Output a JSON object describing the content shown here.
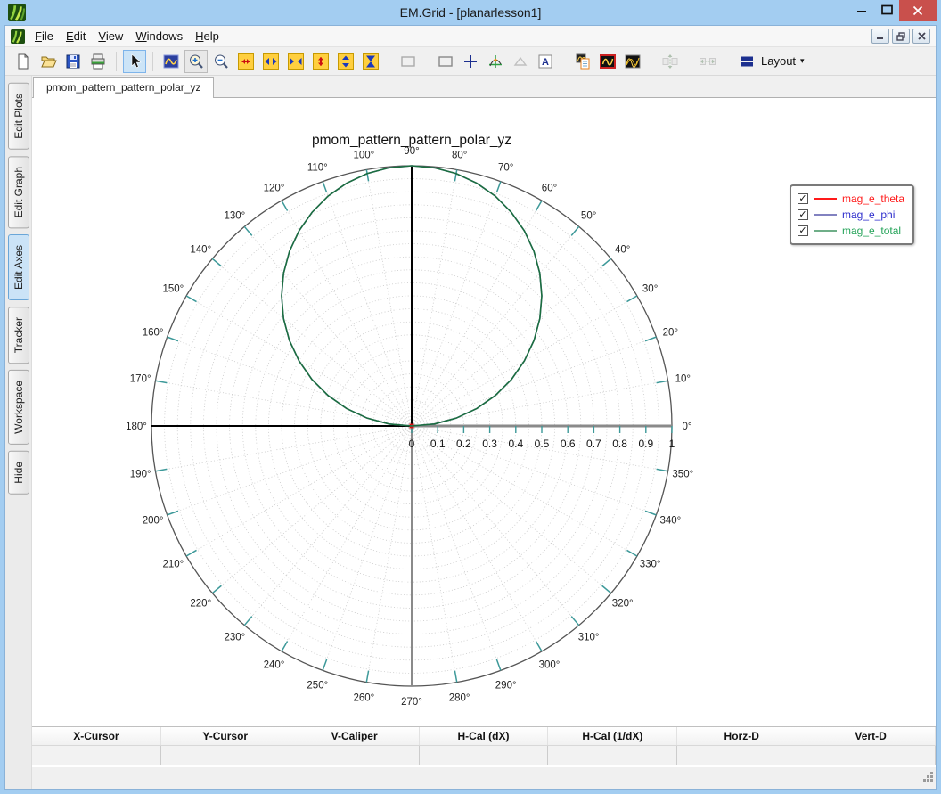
{
  "window": {
    "title": "EM.Grid - [planarlesson1]"
  },
  "menubar": {
    "items": [
      {
        "label": "File",
        "accel": 0
      },
      {
        "label": "Edit",
        "accel": 0
      },
      {
        "label": "View",
        "accel": 0
      },
      {
        "label": "Windows",
        "accel": 0
      },
      {
        "label": "Help",
        "accel": 0
      }
    ],
    "mdi_controls": [
      "mdi-minimize",
      "mdi-restore",
      "mdi-close"
    ]
  },
  "toolbar": {
    "layout_label": "Layout",
    "layout_caret": "▾",
    "buttons": [
      {
        "icon": "new-file"
      },
      {
        "icon": "open-file"
      },
      {
        "icon": "save-file"
      },
      {
        "icon": "print"
      },
      {
        "sep": true
      },
      {
        "icon": "select-cursor",
        "state": "active"
      },
      {
        "sep": true
      },
      {
        "icon": "zoom-window"
      },
      {
        "icon": "zoom-in",
        "state": "toggled"
      },
      {
        "icon": "zoom-out"
      },
      {
        "icon": "expand-x"
      },
      {
        "icon": "shrink-x"
      },
      {
        "icon": "compress-x"
      },
      {
        "icon": "expand-y"
      },
      {
        "icon": "shrink-y"
      },
      {
        "icon": "compress-y"
      },
      {
        "gap": true
      },
      {
        "icon": "select-rect"
      },
      {
        "gap": true
      },
      {
        "icon": "select-rect-2"
      },
      {
        "icon": "crosshair"
      },
      {
        "icon": "tracker-axes"
      },
      {
        "icon": "caliper-triangle",
        "state": "disabled"
      },
      {
        "icon": "add-text"
      },
      {
        "gap": true
      },
      {
        "icon": "show-legend"
      },
      {
        "icon": "plot-frame"
      },
      {
        "icon": "plot-curves"
      },
      {
        "gap": true
      },
      {
        "icon": "fit-vertical",
        "state": "disabled"
      },
      {
        "gap": true
      },
      {
        "icon": "fit-horizontal",
        "state": "disabled"
      },
      {
        "gap": true
      }
    ]
  },
  "sidebar": {
    "tabs": [
      {
        "label": "Edit Plots",
        "active": false
      },
      {
        "label": "Edit Graph",
        "active": false
      },
      {
        "label": "Edit Axes",
        "active": true
      },
      {
        "label": "Tracker",
        "active": false
      },
      {
        "label": "Workspace",
        "active": false
      },
      {
        "label": "Hide",
        "active": false
      }
    ]
  },
  "tabstrip": {
    "tabs": [
      {
        "label": "pmom_pattern_pattern_polar_yz",
        "active": true
      }
    ]
  },
  "chart_data": {
    "type": "polar-line",
    "title": "pmom_pattern_pattern_polar_yz",
    "radial_range": [
      0,
      1
    ],
    "radial_tick_labels": [
      "0",
      "0.1",
      "0.2",
      "0.3",
      "0.4",
      "0.5",
      "0.6",
      "0.7",
      "0.8",
      "0.9",
      "1"
    ],
    "angle_labels": [
      "0°",
      "10°",
      "20°",
      "30°",
      "40°",
      "50°",
      "60°",
      "70°",
      "80°",
      "90°",
      "100°",
      "110°",
      "120°",
      "130°",
      "140°",
      "150°",
      "160°",
      "170°",
      "180°",
      "190°",
      "200°",
      "210°",
      "220°",
      "230°",
      "240°",
      "250°",
      "260°",
      "270°",
      "280°",
      "290°",
      "300°",
      "310°",
      "320°",
      "330°",
      "340°",
      "350°"
    ],
    "spoke_step_deg": 10,
    "ring_step_fraction": 0.05,
    "grid_style": "dotted",
    "legend_position": "right",
    "angles_deg": [
      0,
      5,
      10,
      15,
      20,
      25,
      30,
      35,
      40,
      45,
      50,
      55,
      60,
      65,
      70,
      75,
      80,
      85,
      90,
      95,
      100,
      105,
      110,
      115,
      120,
      125,
      130,
      135,
      140,
      145,
      150,
      155,
      160,
      165,
      170,
      175,
      180,
      185,
      190,
      195,
      200,
      205,
      210,
      215,
      220,
      225,
      230,
      235,
      240,
      245,
      250,
      255,
      260,
      265,
      270,
      275,
      280,
      285,
      290,
      295,
      300,
      305,
      310,
      315,
      320,
      325,
      330,
      335,
      340,
      345,
      350,
      355,
      360
    ],
    "series": [
      {
        "name": "mag_e_theta",
        "color": "#dd1111",
        "values": [
          0,
          0,
          0,
          0,
          0,
          0,
          0,
          0,
          0,
          0,
          0,
          0,
          0,
          0,
          0,
          0,
          0,
          0,
          0,
          0,
          0,
          0,
          0,
          0,
          0,
          0,
          0,
          0,
          0,
          0,
          0,
          0,
          0,
          0,
          0,
          0,
          0,
          0,
          0,
          0,
          0,
          0,
          0,
          0,
          0,
          0,
          0,
          0,
          0,
          0,
          0,
          0,
          0,
          0,
          0,
          0,
          0,
          0,
          0,
          0,
          0,
          0,
          0,
          0,
          0,
          0,
          0,
          0,
          0,
          0,
          0,
          0,
          0
        ]
      },
      {
        "name": "mag_e_phi",
        "color": "#8282c0",
        "values": [
          0,
          0.087,
          0.174,
          0.259,
          0.342,
          0.423,
          0.5,
          0.574,
          0.643,
          0.707,
          0.766,
          0.819,
          0.866,
          0.906,
          0.94,
          0.966,
          0.985,
          0.996,
          1,
          0.996,
          0.985,
          0.966,
          0.94,
          0.906,
          0.866,
          0.819,
          0.766,
          0.707,
          0.643,
          0.574,
          0.5,
          0.423,
          0.342,
          0.259,
          0.174,
          0.087,
          0,
          0,
          0,
          0,
          0,
          0,
          0,
          0,
          0,
          0,
          0,
          0,
          0,
          0,
          0,
          0,
          0,
          0,
          0,
          0,
          0,
          0,
          0,
          0,
          0,
          0,
          0,
          0,
          0,
          0,
          0,
          0,
          0,
          0,
          0,
          0,
          0
        ]
      },
      {
        "name": "mag_e_total",
        "color": "#1b6e3f",
        "values": [
          0,
          0.087,
          0.174,
          0.259,
          0.342,
          0.423,
          0.5,
          0.574,
          0.643,
          0.707,
          0.766,
          0.819,
          0.866,
          0.906,
          0.94,
          0.966,
          0.985,
          0.996,
          1,
          0.996,
          0.985,
          0.966,
          0.94,
          0.906,
          0.866,
          0.819,
          0.766,
          0.707,
          0.643,
          0.574,
          0.5,
          0.423,
          0.342,
          0.259,
          0.174,
          0.087,
          0,
          0,
          0,
          0,
          0,
          0,
          0,
          0,
          0,
          0,
          0,
          0,
          0,
          0,
          0,
          0,
          0,
          0,
          0,
          0,
          0,
          0,
          0,
          0,
          0,
          0,
          0,
          0,
          0,
          0,
          0,
          0,
          0,
          0,
          0,
          0,
          0
        ]
      }
    ]
  },
  "legend": {
    "entries": [
      {
        "label": "mag_e_theta",
        "line_color": "#ff1a1a",
        "text_color": "#ff1a1a",
        "checked": true,
        "check_glyph": "✓"
      },
      {
        "label": "mag_e_phi",
        "line_color": "#8282c0",
        "text_color": "#2d2dcc",
        "checked": true,
        "check_glyph": "✓"
      },
      {
        "label": "mag_e_total",
        "line_color": "#6fae88",
        "text_color": "#26a45a",
        "checked": true,
        "check_glyph": "✓"
      }
    ]
  },
  "cursor_bar": {
    "headers": [
      "X-Cursor",
      "Y-Cursor",
      "V-Caliper",
      "H-Cal (dX)",
      "H-Cal (1/dX)",
      "Horz-D",
      "Vert-D"
    ],
    "values": [
      "",
      "",
      "",
      "",
      "",
      "",
      ""
    ]
  },
  "titlebar_controls": [
    "minimize",
    "maximize",
    "close"
  ]
}
